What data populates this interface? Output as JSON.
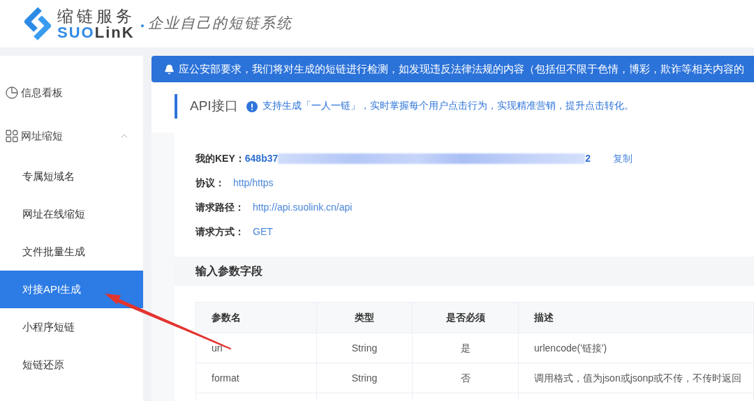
{
  "header": {
    "logo": {
      "title": "缩链服务",
      "wordmark": [
        {
          "text": "SUO",
          "color": "#2e8ae6"
        },
        {
          "text": "LinK",
          "color": "#3d3d3d"
        }
      ]
    },
    "tagline": "企业自己的短链系统"
  },
  "sidebar": {
    "items": [
      {
        "label": "信息看板",
        "kind": "link",
        "selected": false
      },
      {
        "label": "网址缩短",
        "kind": "group",
        "selected": false,
        "expanded": true,
        "children": [
          {
            "label": "专属短域名",
            "selected": false
          },
          {
            "label": "网址在线缩短",
            "selected": false
          },
          {
            "label": "文件批量生成",
            "selected": false
          },
          {
            "label": "对接API生成",
            "selected": true
          },
          {
            "label": "小程序短链",
            "selected": false
          },
          {
            "label": "短链还原",
            "selected": false
          }
        ]
      }
    ]
  },
  "notice": {
    "text": "应公安部要求，我们将对生成的短链进行检测，如发现违反法律法规的内容（包括但不限于色情，博彩，欺诈等相关内容的"
  },
  "api": {
    "title": "API接口",
    "hint": "支持生成「一人一链」，实时掌握每个用户点击行为，实现精准营销，提升点击转化。",
    "key": {
      "label": "我的KEY：",
      "prefix": "648b37",
      "suffix": "2",
      "action": "复制"
    },
    "fields": [
      {
        "label": "协议：",
        "value": "http/https"
      },
      {
        "label": "请求路径：",
        "value": "http://api.suolink.cn/api"
      },
      {
        "label": "请求方式：",
        "value": "GET"
      }
    ]
  },
  "params": {
    "title": "输入参数字段",
    "columns": [
      "参数名",
      "类型",
      "是否必须",
      "描述"
    ],
    "rows": [
      [
        "url",
        "String",
        "是",
        "urlencode('链接')"
      ],
      [
        "format",
        "String",
        "否",
        "调用格式，值为json或jsonp或不传，不传时返回"
      ]
    ]
  }
}
